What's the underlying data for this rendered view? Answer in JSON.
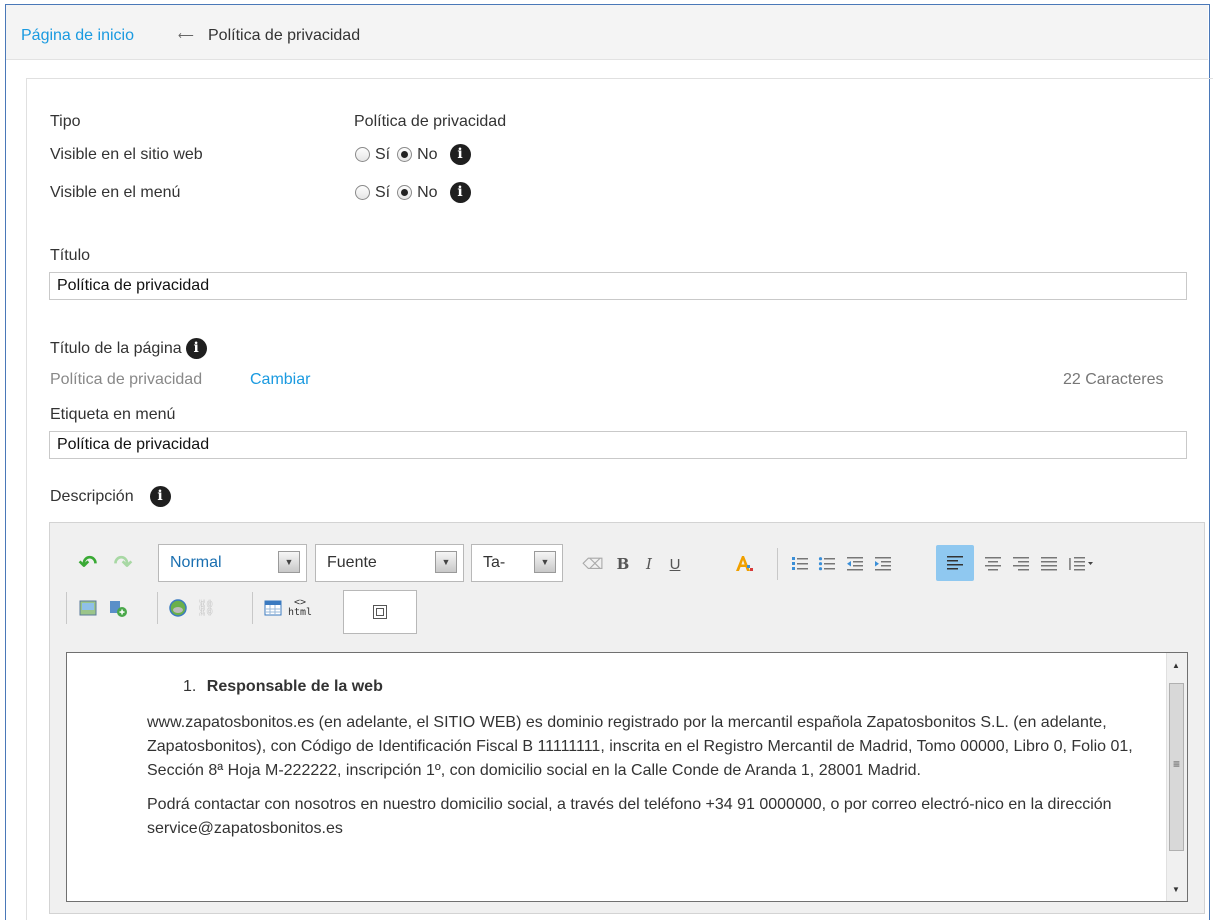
{
  "breadcrumb": {
    "home": "Página de inicio",
    "separator": "⟵",
    "current": "Política de privacidad"
  },
  "form": {
    "type_label": "Tipo",
    "type_value": "Política de privacidad",
    "visible_web_label": "Visible en el sitio web",
    "visible_menu_label": "Visible en el menú",
    "yes": "Sí",
    "no": "No",
    "visible_web_selected": "No",
    "visible_menu_selected": "No",
    "title_label": "Título",
    "title_value": "Política de privacidad",
    "page_title_label": "Título de la página",
    "page_title_value": "Política de privacidad",
    "change_link": "Cambiar",
    "char_count": "22 Caracteres",
    "menu_label_label": "Etiqueta en menú",
    "menu_label_value": "Política de privacidad",
    "description_label": "Descripción"
  },
  "toolbar": {
    "format": "Normal",
    "font": "Fuente",
    "size": "Ta-",
    "bold": "B",
    "italic": "I",
    "underline": "U",
    "html": "<>\nhtml"
  },
  "content": {
    "list_number": "1.",
    "heading": "Responsable de la web",
    "paragraph1": "www.zapatosbonitos.es (en adelante, el SITIO WEB) es dominio registrado por la mercantil española Zapatosbonitos S.L. (en adelante, Zapatosbonitos), con Código de Identificación Fiscal B 11111111, inscrita en el Registro Mercantil de Madrid, Tomo 00000, Libro 0, Folio 01, Sección 8ª Hoja M-222222, inscripción 1º, con domicilio social en la Calle Conde de Aranda 1, 28001 Madrid.",
    "paragraph2": "Podrá contactar con nosotros en nuestro domicilio social, a través del teléfono +34 91 0000000, o por correo electró-nico en la dirección service@zapatosbonitos.es"
  },
  "colors": {
    "link": "#1a9ae0",
    "frame": "#4a78b8",
    "undo_green": "#3aaa35"
  }
}
